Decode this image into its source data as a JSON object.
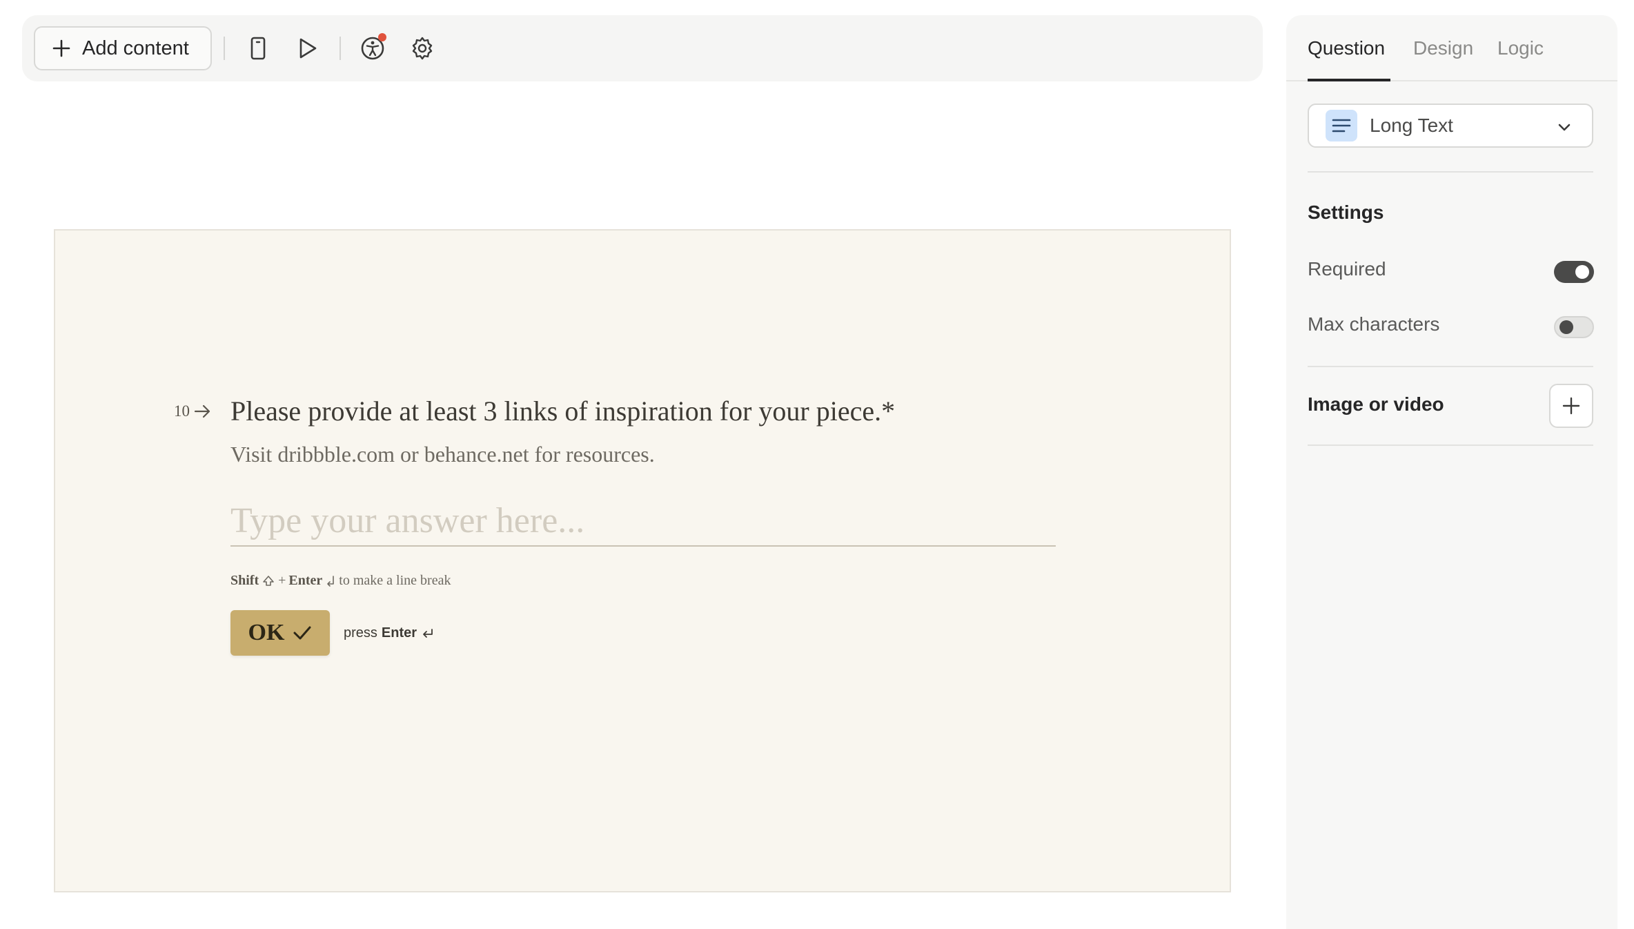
{
  "toolbar": {
    "add_content_label": "Add content",
    "icons": [
      "plus-icon",
      "mobile-preview-icon",
      "play-icon",
      "accessibility-icon",
      "settings-gear-icon"
    ],
    "notification_color": "#e0533d"
  },
  "question": {
    "number": "10",
    "title": "Please provide at least 3 links of inspiration for your piece.*",
    "description": "Visit dribbble.com or behance.net for resources.",
    "answer_placeholder": "Type your answer here...",
    "answer_value": "",
    "hint_shift": "Shift",
    "hint_plus": "+",
    "hint_enter": "Enter",
    "hint_suffix": "to make a line break",
    "ok_label": "OK",
    "press_label": "press",
    "press_key": "Enter",
    "accent_color": "#c8ad6e",
    "background_color": "#f9f6ef"
  },
  "panel": {
    "tabs": [
      {
        "label": "Question",
        "active": true
      },
      {
        "label": "Design",
        "active": false
      },
      {
        "label": "Logic",
        "active": false
      }
    ],
    "type_select": {
      "value": "Long Text",
      "icon": "long-text-icon"
    },
    "settings_heading": "Settings",
    "settings": [
      {
        "label": "Required",
        "enabled": true
      },
      {
        "label": "Max characters",
        "enabled": false
      }
    ],
    "image_or_video_label": "Image or video"
  }
}
